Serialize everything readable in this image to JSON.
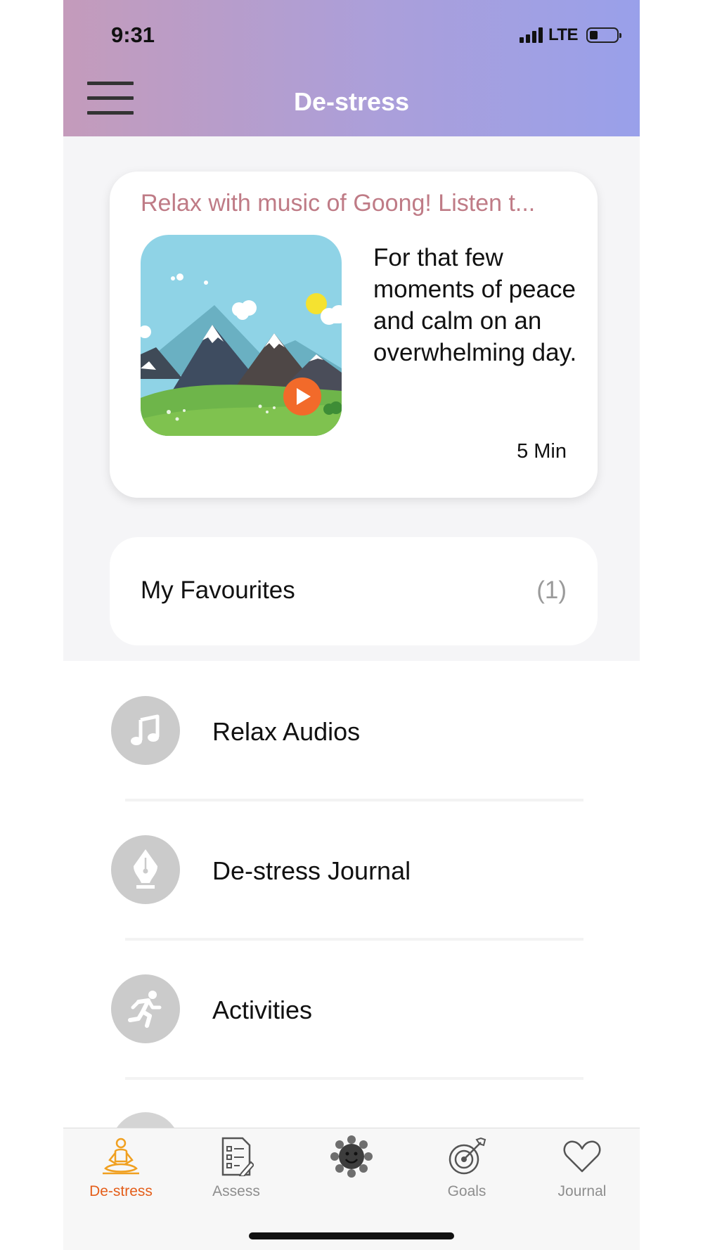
{
  "status_bar": {
    "time": "9:31",
    "network": "LTE"
  },
  "header": {
    "title": "De-stress"
  },
  "featured": {
    "title": "Relax with music of Goong! Listen t...",
    "description": "For that few moments of peace and calm on an overwhelming day.",
    "duration": "5 Min"
  },
  "favourites": {
    "label": "My Favourites",
    "count": "(1)"
  },
  "list": [
    {
      "label": "Relax Audios",
      "icon": "music-note-icon"
    },
    {
      "label": "De-stress Journal",
      "icon": "pen-nib-icon"
    },
    {
      "label": "Activities",
      "icon": "running-person-icon"
    }
  ],
  "tabs": [
    {
      "label": "De-stress",
      "icon": "meditation-icon",
      "active": true
    },
    {
      "label": "Assess",
      "icon": "checklist-icon",
      "active": false
    },
    {
      "label": "",
      "icon": "sunflower-icon",
      "active": false
    },
    {
      "label": "Goals",
      "icon": "target-icon",
      "active": false
    },
    {
      "label": "Journal",
      "icon": "heart-icon",
      "active": false
    }
  ],
  "colors": {
    "header_gradient": [
      "#c49bbb",
      "#99a0ea"
    ],
    "featured_title": "#bf7b86",
    "active_tab": "#e45e1a",
    "play_button": "#f26a2a",
    "icon_circle": "#cbcbcb"
  }
}
